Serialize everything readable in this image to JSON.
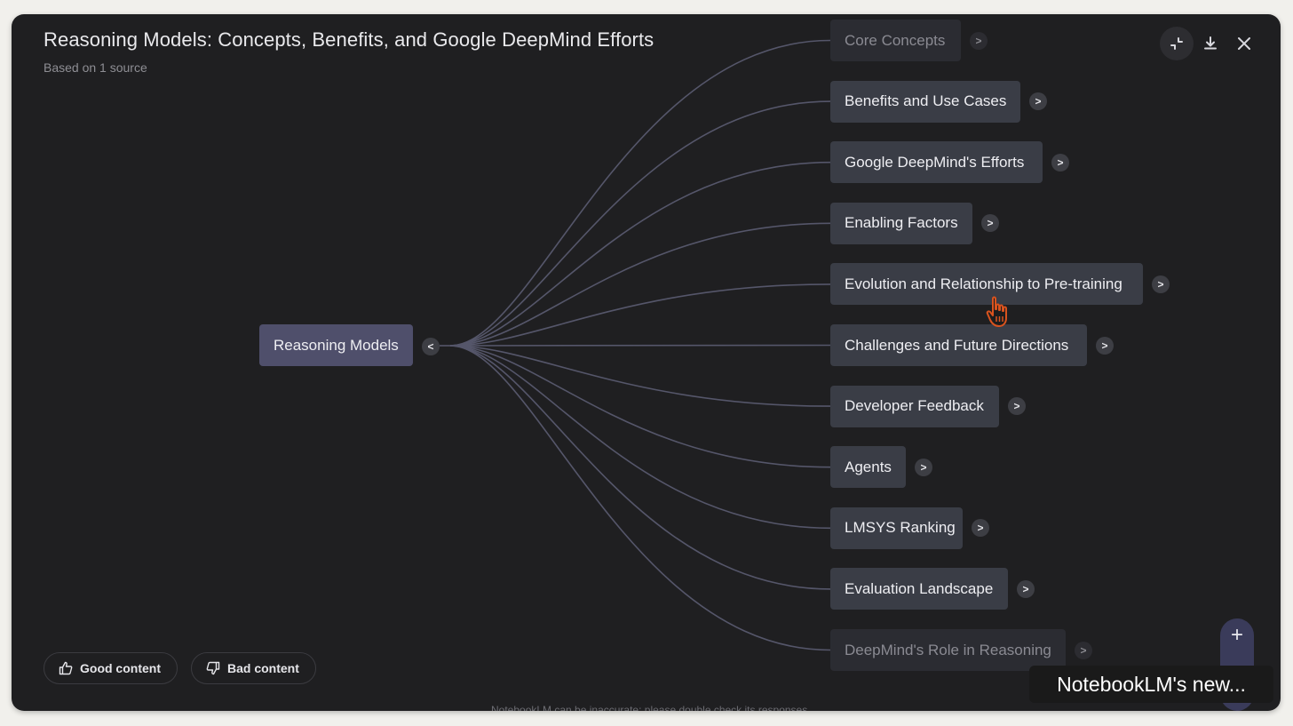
{
  "header": {
    "title": "Reasoning Models: Concepts, Benefits, and Google DeepMind Efforts",
    "subtitle": "Based on 1 source",
    "actions": [
      {
        "icon": "collapse-icon",
        "label": "collapse"
      },
      {
        "icon": "download-icon",
        "label": "download"
      },
      {
        "icon": "close-icon",
        "label": "close"
      }
    ]
  },
  "mindmap": {
    "root": {
      "label": "Reasoning Models",
      "expander": "<"
    },
    "children": [
      {
        "label": "Core Concepts",
        "expander": ">",
        "faded": true
      },
      {
        "label": "Benefits and Use Cases",
        "expander": ">"
      },
      {
        "label": "Google DeepMind's Efforts",
        "expander": ">"
      },
      {
        "label": "Enabling Factors",
        "expander": ">"
      },
      {
        "label": "Evolution and Relationship to Pre-training",
        "expander": ">"
      },
      {
        "label": "Challenges and Future Directions",
        "expander": ">"
      },
      {
        "label": "Developer Feedback",
        "expander": ">"
      },
      {
        "label": "Agents",
        "expander": ">"
      },
      {
        "label": "LMSYS Ranking",
        "expander": ">"
      },
      {
        "label": "Evaluation Landscape",
        "expander": ">"
      },
      {
        "label": "DeepMind's Role in Reasoning",
        "expander": ">",
        "faded": true
      }
    ],
    "edge_color": "#55566a"
  },
  "feedback": {
    "good_label": "Good content",
    "bad_label": "Bad content"
  },
  "zoom": {
    "in_label": "+",
    "out_label": "−"
  },
  "footer": {
    "disclaimer": "NotebookLM can be inaccurate; please double check its responses."
  },
  "overlay_caption": "NotebookLM's new...",
  "colors": {
    "background": "#1f1f21",
    "node": "#3a3d46",
    "root_node": "#4f4f6b",
    "text": "#eeeef2",
    "cursor_accent": "#d9531e"
  }
}
